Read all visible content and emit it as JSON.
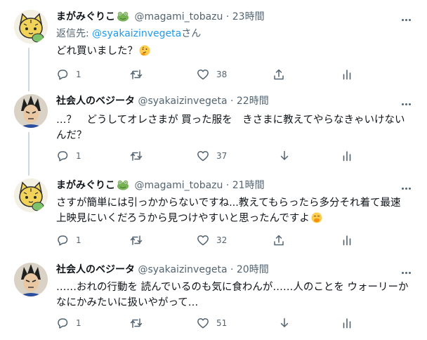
{
  "colors": {
    "accent": "#1d9bf0",
    "secondary_text": "#536471",
    "divider": "#eff3f4",
    "thread_line": "#cfd9de"
  },
  "tweets": [
    {
      "name": "まがみぐりこ",
      "name_icon": "frog-emoji",
      "handle": "@magami_tobazu",
      "sep": "·",
      "time": "23時間",
      "reply_prefix": "返信先: ",
      "reply_handle": "@syakaizinvegeta",
      "reply_suffix": "さん",
      "lines": [
        "どれ買いました？"
      ],
      "trailing_emoji": "thinking-face-emoji",
      "replies": "1",
      "retweets": "",
      "likes": "38",
      "last_icon": "share-icon",
      "analytics_icon": "analytics-icon"
    },
    {
      "name": "社会人のベジータ",
      "handle": "@syakaizinvegeta",
      "sep": "·",
      "time": "22時間",
      "lines": [
        "…？　どうしてオレさまが 買った服を　きさまに教えてやらなきゃいけない",
        "んだ？"
      ],
      "replies": "1",
      "retweets": "",
      "likes": "37",
      "last_icon": "down-arrow-icon",
      "analytics_icon": "analytics-icon"
    },
    {
      "name": "まがみぐりこ",
      "name_icon": "frog-emoji",
      "handle": "@magami_tobazu",
      "sep": "·",
      "time": "21時間",
      "lines": [
        "さすが簡単には引っかからないですね...教えてもらったら多分それ着て最速",
        "上映見にいくだろうから見つけやすいと思ったんですよ"
      ],
      "trailing_emoji": "face-with-hand-over-mouth-emoji",
      "replies": "1",
      "retweets": "",
      "likes": "32",
      "last_icon": "share-icon",
      "analytics_icon": "analytics-icon"
    },
    {
      "name": "社会人のベジータ",
      "handle": "@syakaizinvegeta",
      "sep": "·",
      "time": "20時間",
      "lines": [
        "……おれの行動を 読んでいるのも気に食わんが……人のことを ウォーリーか",
        "なにかみたいに扱いやがって…"
      ],
      "replies": "1",
      "retweets": "",
      "likes": "51",
      "last_icon": "down-arrow-icon",
      "analytics_icon": "analytics-icon"
    }
  ]
}
